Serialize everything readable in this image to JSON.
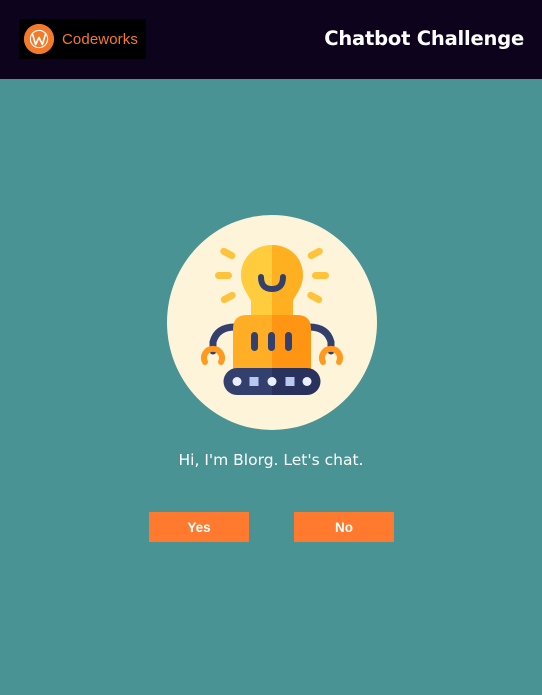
{
  "header": {
    "logo_text": "Codeworks",
    "title": "Chatbot Challenge"
  },
  "bot": {
    "greeting": "Hi, I'm Blorg. Let's chat."
  },
  "actions": {
    "yes_label": "Yes",
    "no_label": "No"
  },
  "colors": {
    "header_bg": "#0e031d",
    "page_bg": "#4a9394",
    "accent": "#ff7a2f",
    "avatar_bg": "#fdf4da"
  },
  "icons": {
    "logo": "codeworks-w-icon",
    "bot": "robot-lightbulb-icon"
  }
}
